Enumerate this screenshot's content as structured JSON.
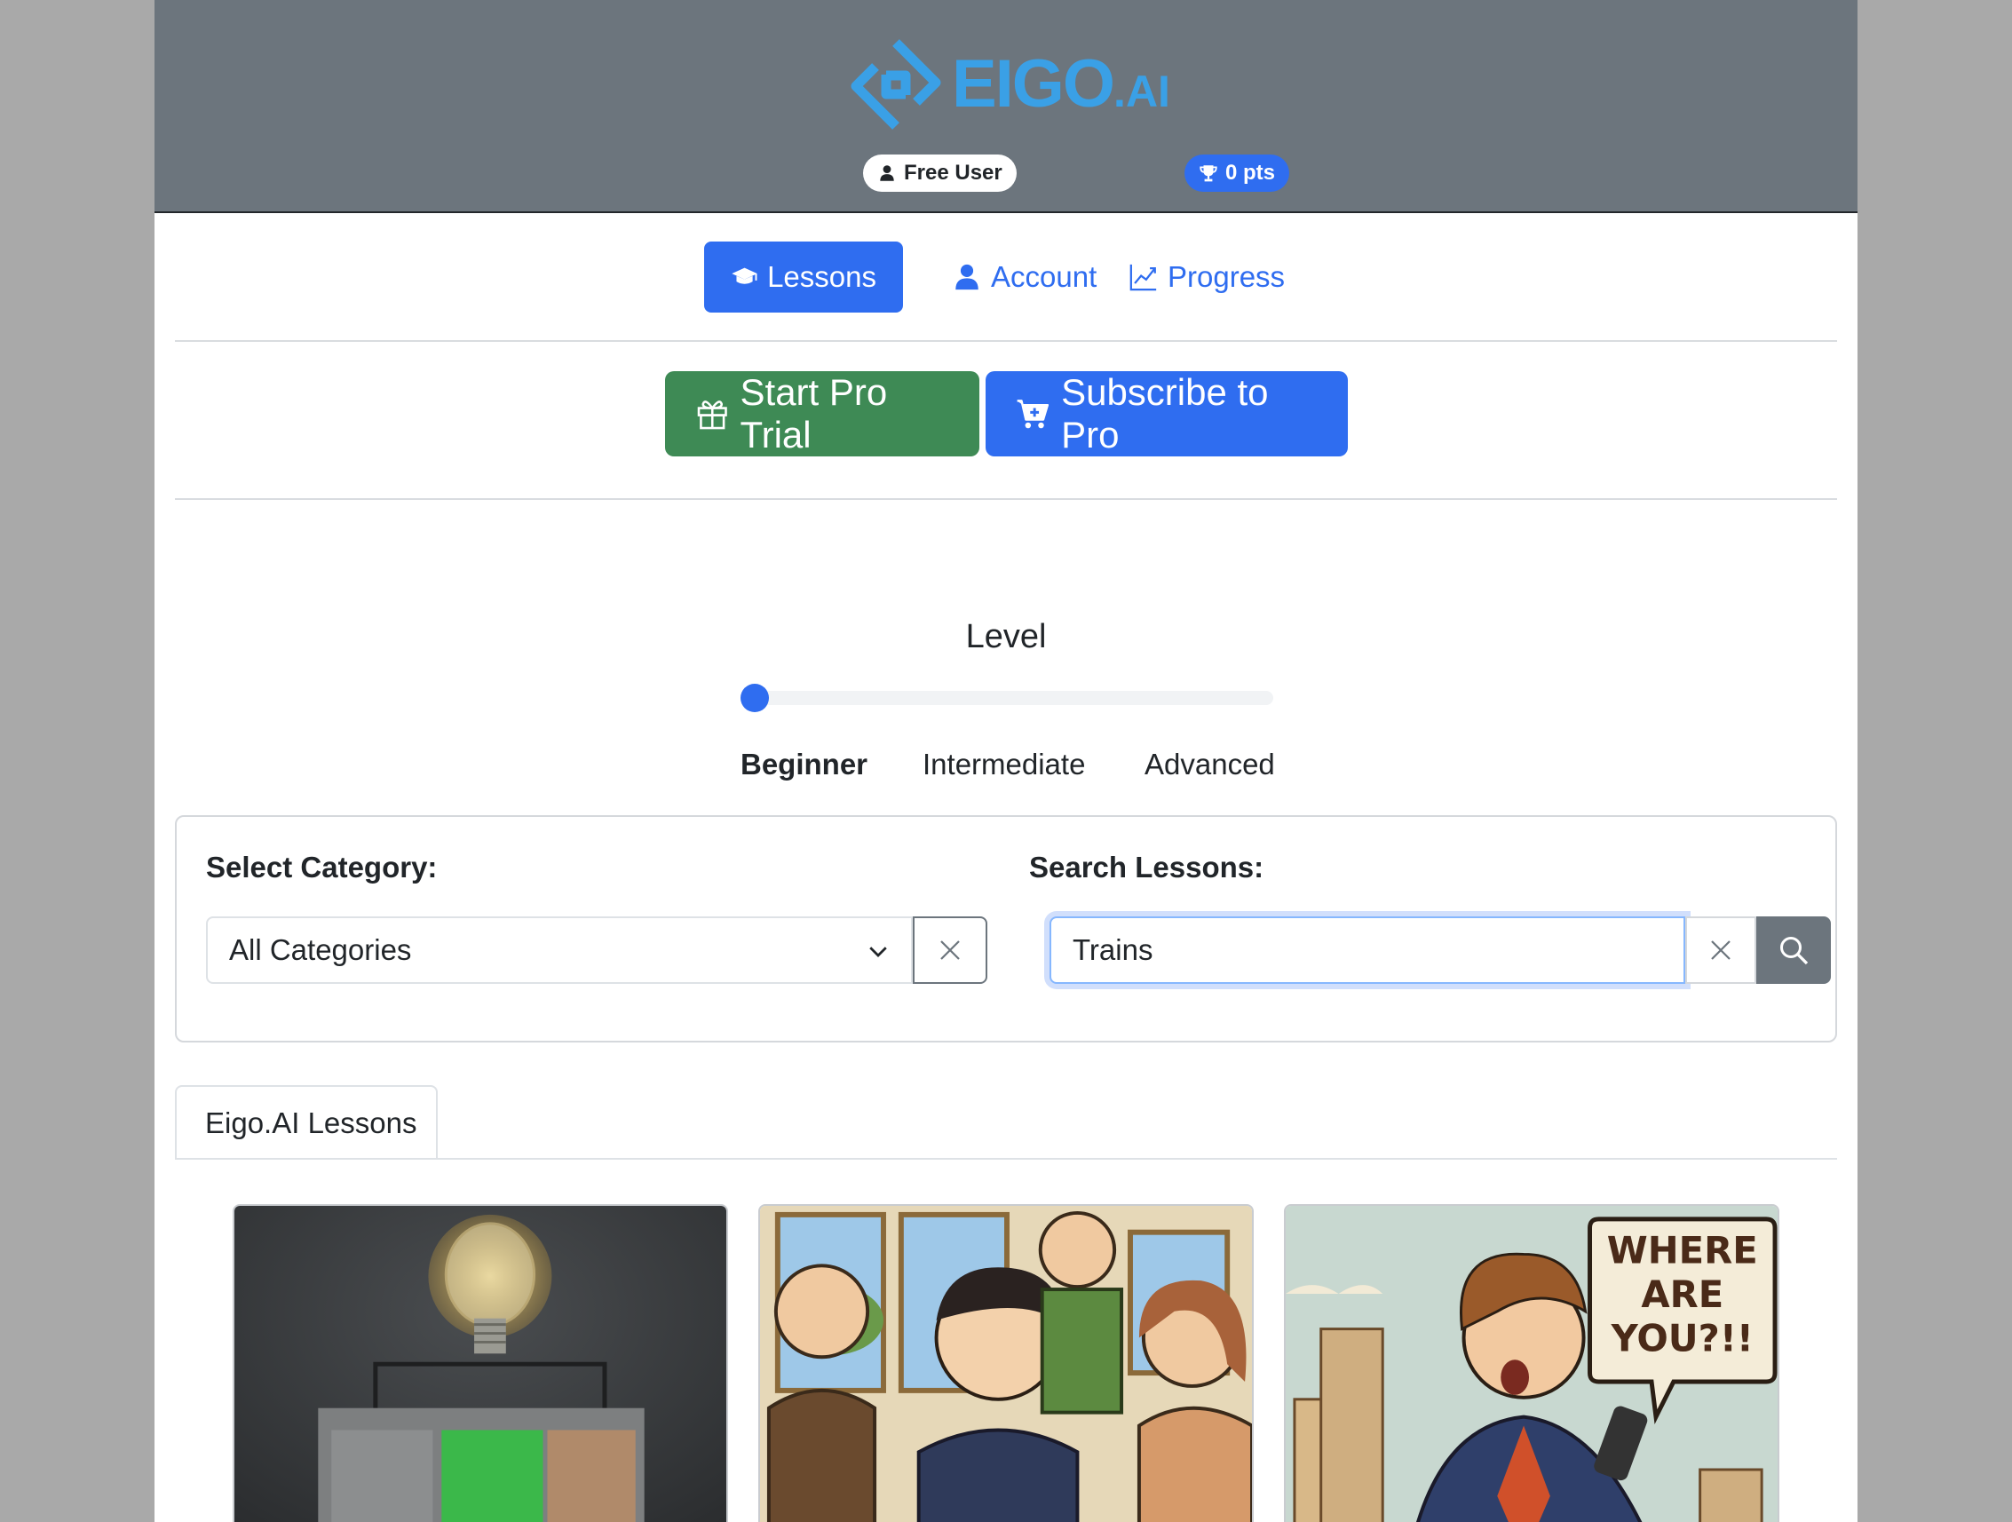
{
  "header": {
    "logo_text": "EIGO",
    "logo_suffix": ".AI",
    "user_badge": "Free User",
    "points_badge": "0 pts"
  },
  "nav": {
    "tabs": [
      {
        "label": "Lessons",
        "icon": "graduation-cap-icon",
        "active": true
      },
      {
        "label": "Account",
        "icon": "person-icon",
        "active": false
      },
      {
        "label": "Progress",
        "icon": "chart-line-icon",
        "active": false
      }
    ]
  },
  "pro": {
    "trial_label": "Start Pro Trial",
    "subscribe_label": "Subscribe to Pro"
  },
  "level": {
    "title": "Level",
    "options": [
      "Beginner",
      "Intermediate",
      "Advanced"
    ],
    "selected": "Beginner",
    "slider_value": 0
  },
  "filters": {
    "category_label": "Select Category:",
    "category_value": "All Categories",
    "search_label": "Search Lessons:",
    "search_value": "Trains"
  },
  "lessons": {
    "tab_label": "Eigo.AI Lessons",
    "cards": [
      {
        "image": "lightbulb-on-box-illustration"
      },
      {
        "image": "people-on-train-illustration"
      },
      {
        "image": "man-with-phone-comic"
      }
    ],
    "speech_bubble": [
      "WHERE",
      "ARE",
      "YOU?!!"
    ]
  },
  "colors": {
    "header_bg": "#6c757d",
    "primary": "#2f6df0",
    "success": "#3e8a55",
    "logo": "#3aa0e6"
  }
}
